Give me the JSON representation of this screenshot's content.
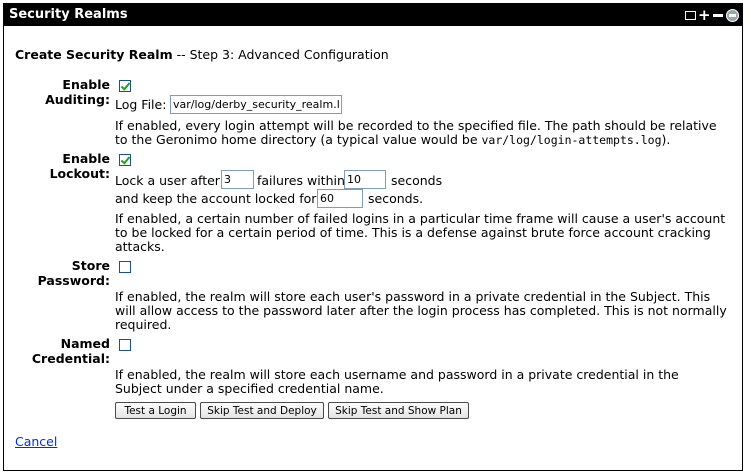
{
  "portlet": {
    "title": "Security Realms"
  },
  "heading": {
    "title": "Create Security Realm",
    "separator": " -- ",
    "step": "Step 3: Advanced Configuration"
  },
  "auditing": {
    "label_line1": "Enable",
    "label_line2": "Auditing:",
    "checked": true,
    "logfile_label": "Log File:",
    "logfile_value": "var/log/derby_security_realm.log",
    "desc_part1": "If enabled, every login attempt will be recorded to the specified file. The path should be relative to the Geronimo home directory (a typical value would be ",
    "desc_code": "var/log/login-attempts.log",
    "desc_part2": ")."
  },
  "lockout": {
    "label_line1": "Enable",
    "label_line2": "Lockout:",
    "checked": true,
    "text_lock_user": "Lock a user after",
    "failures_value": "3",
    "text_failures_within": "failures within",
    "within_value": "10",
    "text_seconds1": "seconds",
    "text_keep": "and keep the account locked for",
    "locked_value": "60",
    "text_seconds2": "seconds.",
    "desc": "If enabled, a certain number of failed logins in a particular time frame will cause a user's account to be locked for a certain period of time. This is a defense against brute force account cracking attacks."
  },
  "store_password": {
    "label_line1": "Store",
    "label_line2": "Password:",
    "checked": false,
    "desc": "If enabled, the realm will store each user's password in a private credential in the Subject. This will allow access to the password later after the login process has completed. This is not normally required."
  },
  "named_credential": {
    "label_line1": "Named",
    "label_line2": "Credential:",
    "checked": false,
    "desc": "If enabled, the realm will store each username and password in a private credential in the Subject under a specified credential name."
  },
  "buttons": {
    "test_login": "Test a Login",
    "skip_deploy": "Skip Test and Deploy",
    "skip_plan": "Skip Test and Show Plan"
  },
  "cancel_link": "Cancel",
  "colors": {
    "titlebar_bg": "#000000",
    "link": "#0033cc",
    "check": "#21a121"
  }
}
